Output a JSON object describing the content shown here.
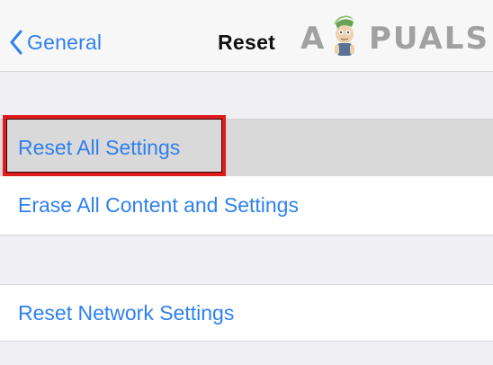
{
  "navbar": {
    "back_label": "General",
    "title": "Reset",
    "back_icon": "chevron-left-icon"
  },
  "watermark": {
    "text": "APPUALS",
    "icon": "appuals-mascot-logo"
  },
  "settings": {
    "group1": [
      "Reset All Settings",
      "Erase All Content and Settings"
    ],
    "group2": [
      "Reset Network Settings"
    ]
  },
  "colors": {
    "accent": "#2f80ee",
    "highlight_border": "#dd1d1d",
    "background": "#efeff4",
    "selected_row": "#d9d9d9"
  }
}
